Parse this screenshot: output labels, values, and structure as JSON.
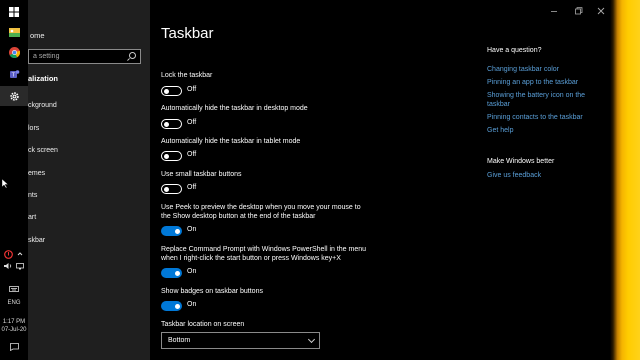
{
  "taskbar": {
    "time": "1:17 PM",
    "date": "07-Jul-20",
    "language": "ENG"
  },
  "nav": {
    "home_label": "ome",
    "search_placeholder": "a setting",
    "section_label": "alization",
    "items": [
      {
        "label": "ckground"
      },
      {
        "label": "lors"
      },
      {
        "label": "ck screen"
      },
      {
        "label": "emes"
      },
      {
        "label": "nts"
      },
      {
        "label": "art"
      },
      {
        "label": "skbar"
      }
    ]
  },
  "main": {
    "title": "Taskbar",
    "settings": [
      {
        "label": "Lock the taskbar",
        "state": "Off"
      },
      {
        "label": "Automatically hide the taskbar in desktop mode",
        "state": "Off"
      },
      {
        "label": "Automatically hide the taskbar in tablet mode",
        "state": "Off"
      },
      {
        "label": "Use small taskbar buttons",
        "state": "Off"
      },
      {
        "label_line1": "Use Peek to preview the desktop when you move your mouse to",
        "label_line2": "the Show desktop button at the end of the taskbar",
        "state": "On"
      },
      {
        "label_line1": "Replace Command Prompt with Windows PowerShell in the menu",
        "label_line2": "when I right-click the start button or press Windows key+X",
        "state": "On"
      },
      {
        "label": "Show badges on taskbar buttons",
        "state": "On"
      }
    ],
    "location": {
      "label": "Taskbar location on screen",
      "value": "Bottom"
    }
  },
  "help": {
    "question_heading": "Have a question?",
    "links": [
      "Changing taskbar color",
      "Pinning an app to the taskbar",
      "Showing the battery icon on the taskbar",
      "Pinning contacts to the taskbar",
      "Get help"
    ],
    "better_heading": "Make Windows better",
    "feedback_link": "Give us feedback"
  },
  "colors": {
    "accent": "#0078d7",
    "link": "#5a9fd8",
    "nav_bg": "#1f1f1f"
  }
}
